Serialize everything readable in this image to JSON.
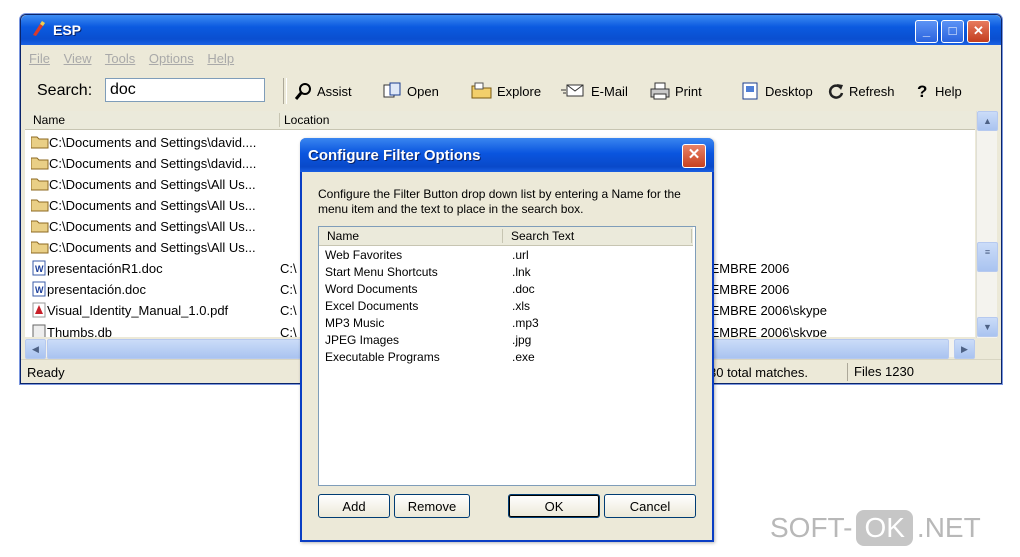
{
  "window": {
    "title": "ESP"
  },
  "menu": [
    "File",
    "View",
    "Tools",
    "Options",
    "Help"
  ],
  "search": {
    "label": "Search:",
    "value": "doc"
  },
  "toolbar": {
    "assist": "Assist",
    "open": "Open",
    "explore": "Explore",
    "email": "E-Mail",
    "print": "Print",
    "desktop": "Desktop",
    "refresh": "Refresh",
    "help": "Help"
  },
  "list": {
    "headers": {
      "name": "Name",
      "location": "Location"
    },
    "rows": [
      {
        "name": "C:\\Documents and Settings\\david....",
        "location": "",
        "icon": "folder-icon"
      },
      {
        "name": "C:\\Documents and Settings\\david....",
        "location": "",
        "icon": "folder-icon"
      },
      {
        "name": "C:\\Documents and Settings\\All Us...",
        "location": "",
        "icon": "folder-icon"
      },
      {
        "name": "C:\\Documents and Settings\\All Us...",
        "location": "",
        "icon": "folder-icon"
      },
      {
        "name": "C:\\Documents and Settings\\All Us...",
        "location": "",
        "icon": "folder-icon"
      },
      {
        "name": "C:\\Documents and Settings\\All Us...",
        "location": "",
        "icon": "folder-icon"
      },
      {
        "name": "presentaciónR1.doc",
        "location": "C:\\",
        "tail": "IEMBRE 2006",
        "icon": "word-doc-icon"
      },
      {
        "name": "presentación.doc",
        "location": "C:\\",
        "tail": "IEMBRE 2006",
        "icon": "word-doc-icon"
      },
      {
        "name": "Visual_Identity_Manual_1.0.pdf",
        "location": "C:\\",
        "tail": "IEMBRE 2006\\skype",
        "icon": "pdf-icon"
      },
      {
        "name": "Thumbs.db",
        "location": "C:\\",
        "tail": "IEMBRE 2006\\skype",
        "icon": "db-icon"
      }
    ]
  },
  "status": {
    "ready": "Ready",
    "matches": "30 total matches.",
    "files": "Files 1230"
  },
  "dialog": {
    "title": "Configure Filter Options",
    "description": "Configure the Filter Button drop down list by entering a Name for the menu item and the text to place in the search box.",
    "headers": {
      "name": "Name",
      "search_text": "Search Text"
    },
    "rows": [
      {
        "name": "Web Favorites",
        "text": ".url"
      },
      {
        "name": "Start Menu Shortcuts",
        "text": ".lnk"
      },
      {
        "name": "Word Documents",
        "text": ".doc"
      },
      {
        "name": "Excel Documents",
        "text": ".xls"
      },
      {
        "name": "MP3 Music",
        "text": ".mp3"
      },
      {
        "name": "JPEG Images",
        "text": ".jpg"
      },
      {
        "name": "Executable Programs",
        "text": ".exe"
      }
    ],
    "buttons": {
      "add": "Add",
      "remove": "Remove",
      "ok": "OK",
      "cancel": "Cancel"
    }
  },
  "watermark": {
    "left": "SOFT-",
    "mid": "OK",
    "right": ".NET"
  }
}
